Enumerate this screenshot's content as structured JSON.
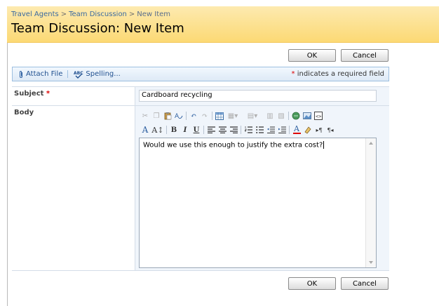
{
  "breadcrumb": {
    "items": [
      "Travel Agents",
      "Team Discussion",
      "New Item"
    ],
    "separator": ">"
  },
  "page_title": "Team Discussion: New Item",
  "buttons": {
    "ok": "OK",
    "cancel": "Cancel"
  },
  "toolbar": {
    "attach_file": "Attach File",
    "spelling": "Spelling...",
    "required_star": "*",
    "required_note": "indicates a required field"
  },
  "form": {
    "subject": {
      "label": "Subject",
      "required_star": "*",
      "value": "Cardboard recycling"
    },
    "body": {
      "label": "Body",
      "value": "Would we use this enough to justify the extra cost?"
    }
  },
  "rte_toolbar": {
    "row1": [
      "cut-icon",
      "copy-icon",
      "paste-icon",
      "format-painter-icon",
      "undo-icon",
      "redo-icon",
      "insert-table-icon",
      "table-options-icon",
      "table-dropdown-icon",
      "cell-icon",
      "merge-icon",
      "insert-link-icon",
      "insert-image-icon",
      "html-source-icon"
    ],
    "row2": {
      "font_color_a": "A",
      "font_size": "A↕",
      "bold": "B",
      "italic": "I",
      "underline": "U",
      "text_color": "A"
    }
  },
  "colors": {
    "header_bg": "#fcd974",
    "link": "#3b6aa0",
    "required": "#dd0000"
  }
}
